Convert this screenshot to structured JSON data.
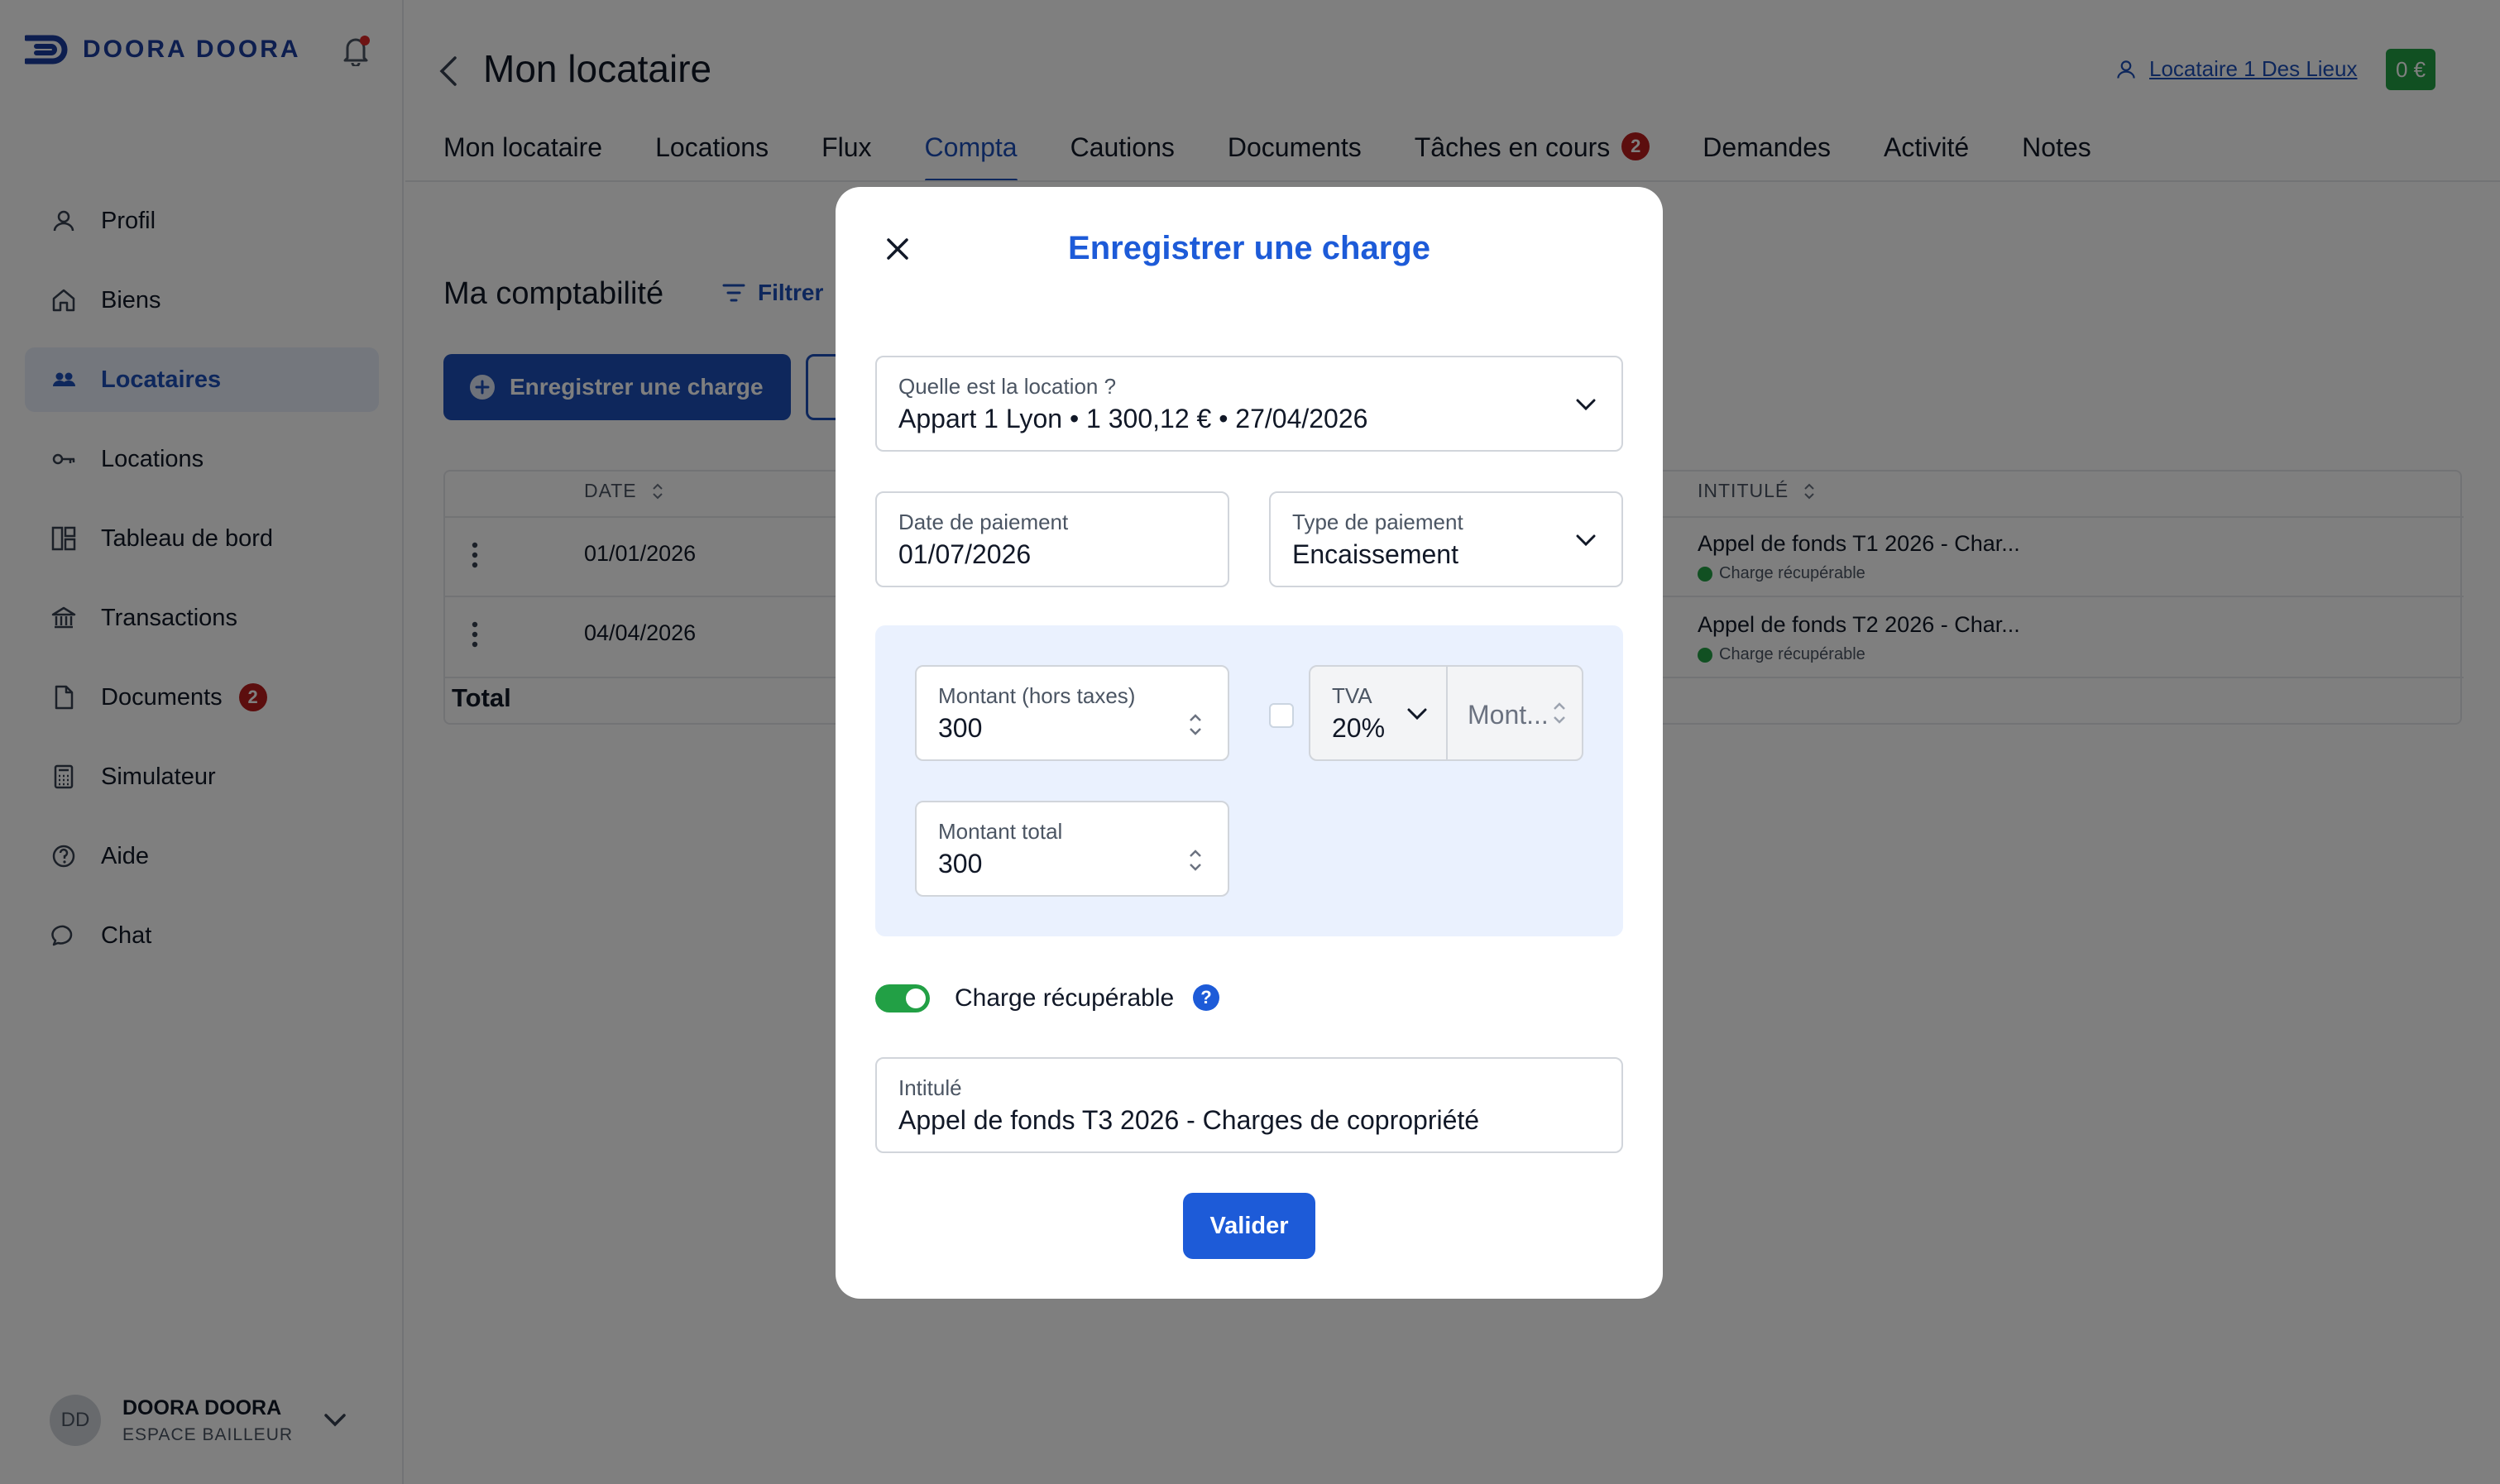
{
  "brand": {
    "name": "DOORA DOORA",
    "accent": "#1d4fb8"
  },
  "sidebar": {
    "items": [
      {
        "label": "Profil",
        "icon": "user-icon"
      },
      {
        "label": "Biens",
        "icon": "home-icon"
      },
      {
        "label": "Locataires",
        "icon": "users-icon",
        "active": true
      },
      {
        "label": "Locations",
        "icon": "key-icon"
      },
      {
        "label": "Tableau de bord",
        "icon": "dashboard-icon"
      },
      {
        "label": "Transactions",
        "icon": "bank-icon"
      },
      {
        "label": "Documents",
        "icon": "document-icon",
        "badge": "2"
      },
      {
        "label": "Simulateur",
        "icon": "calculator-icon"
      },
      {
        "label": "Aide",
        "icon": "help-icon"
      },
      {
        "label": "Chat",
        "icon": "chat-icon"
      }
    ],
    "user": {
      "initials": "DD",
      "name": "DOORA DOORA",
      "role": "ESPACE BAILLEUR"
    }
  },
  "header": {
    "title": "Mon locataire",
    "tenant_link": "Locataire 1 Des Lieux",
    "balance": "0 €"
  },
  "tabs": [
    {
      "label": "Mon locataire"
    },
    {
      "label": "Locations"
    },
    {
      "label": "Flux"
    },
    {
      "label": "Compta",
      "active": true
    },
    {
      "label": "Cautions"
    },
    {
      "label": "Documents"
    },
    {
      "label": "Tâches en cours",
      "badge": "2"
    },
    {
      "label": "Demandes"
    },
    {
      "label": "Activité"
    },
    {
      "label": "Notes"
    }
  ],
  "compta": {
    "title": "Ma comptabilité",
    "filter_label": "Filtrer",
    "add_button": "Enregistrer une charge",
    "columns": {
      "date": "DATE",
      "intitule": "INTITULÉ"
    },
    "rows": [
      {
        "date": "01/01/2026",
        "title": "Appel de fonds T1 2026 - Char...",
        "tag": "Charge récupérable"
      },
      {
        "date": "04/04/2026",
        "title": "Appel de fonds T2 2026 - Char...",
        "tag": "Charge récupérable"
      }
    ],
    "total_label": "Total"
  },
  "modal": {
    "title": "Enregistrer une charge",
    "location": {
      "label": "Quelle est la location ?",
      "value": "Appart 1 Lyon • 1 300,12 € • 27/04/2026"
    },
    "date_paiement": {
      "label": "Date de paiement",
      "value": "01/07/2026"
    },
    "type_paiement": {
      "label": "Type de paiement",
      "value": "Encaissement"
    },
    "montant_ht": {
      "label": "Montant (hors taxes)",
      "value": "300"
    },
    "tva": {
      "label": "TVA",
      "value": "20%"
    },
    "montant_tva": {
      "placeholder": "Mont..."
    },
    "montant_total": {
      "label": "Montant total",
      "value": "300"
    },
    "recuperable": {
      "label": "Charge récupérable",
      "checked": true
    },
    "intitule": {
      "label": "Intitulé",
      "value": "Appel de fonds T3 2026 - Charges de copropriété"
    },
    "submit": "Valider"
  }
}
